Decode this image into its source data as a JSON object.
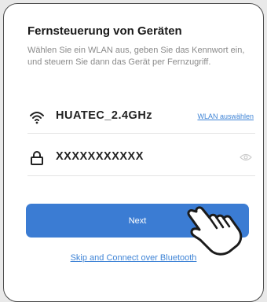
{
  "dialog": {
    "title": "Fernsteuerung von Geräten",
    "description": "Wählen Sie ein WLAN aus, geben Sie das Kennwort ein, und steuern Sie dann das Gerät per Fernzugriff."
  },
  "wifi": {
    "icon": "wifi-icon",
    "ssid": "HUATEC_2.4GHz",
    "select_link": "WLAN auswählen"
  },
  "password": {
    "icon": "lock-icon",
    "value": "XXXXXXXXXXX",
    "toggle_icon": "eye-icon"
  },
  "actions": {
    "next_label": "Next",
    "bluetooth_link": "Skip and Connect over Bluetooth"
  },
  "colors": {
    "accent": "#3b7cd3",
    "link": "#3f84d6"
  }
}
